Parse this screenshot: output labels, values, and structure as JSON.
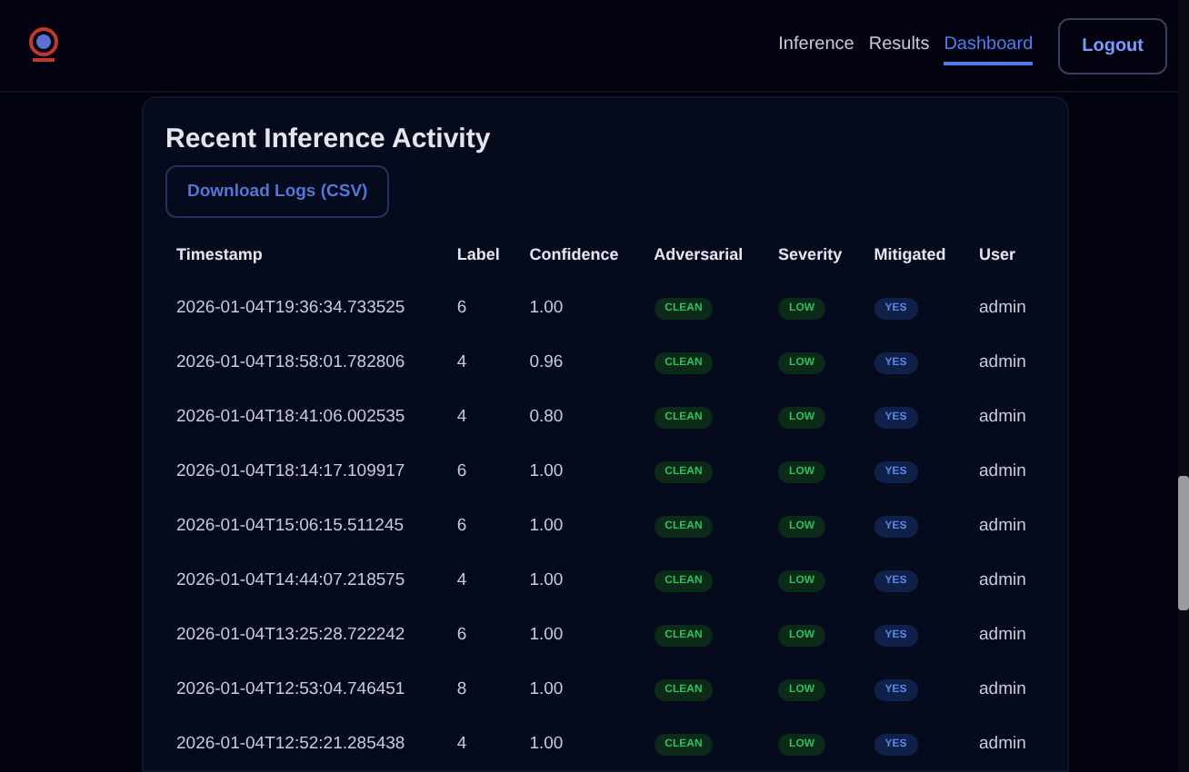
{
  "nav": {
    "links": [
      {
        "label": "Inference",
        "selected": false
      },
      {
        "label": "Results",
        "selected": false
      },
      {
        "label": "Dashboard",
        "selected": true
      }
    ],
    "logout": "Logout"
  },
  "card": {
    "title": "Recent Inference Activity",
    "download_button": "Download Logs (CSV)"
  },
  "table": {
    "columns": [
      "Timestamp",
      "Label",
      "Confidence",
      "Adversarial",
      "Severity",
      "Mitigated",
      "User"
    ],
    "rows": [
      {
        "timestamp": "2026-01-04T19:36:34.733525",
        "label": "6",
        "confidence": "1.00",
        "adversarial": "CLEAN",
        "severity": "LOW",
        "mitigated": "YES",
        "user": "admin"
      },
      {
        "timestamp": "2026-01-04T18:58:01.782806",
        "label": "4",
        "confidence": "0.96",
        "adversarial": "CLEAN",
        "severity": "LOW",
        "mitigated": "YES",
        "user": "admin"
      },
      {
        "timestamp": "2026-01-04T18:41:06.002535",
        "label": "4",
        "confidence": "0.80",
        "adversarial": "CLEAN",
        "severity": "LOW",
        "mitigated": "YES",
        "user": "admin"
      },
      {
        "timestamp": "2026-01-04T18:14:17.109917",
        "label": "6",
        "confidence": "1.00",
        "adversarial": "CLEAN",
        "severity": "LOW",
        "mitigated": "YES",
        "user": "admin"
      },
      {
        "timestamp": "2026-01-04T15:06:15.511245",
        "label": "6",
        "confidence": "1.00",
        "adversarial": "CLEAN",
        "severity": "LOW",
        "mitigated": "YES",
        "user": "admin"
      },
      {
        "timestamp": "2026-01-04T14:44:07.218575",
        "label": "4",
        "confidence": "1.00",
        "adversarial": "CLEAN",
        "severity": "LOW",
        "mitigated": "YES",
        "user": "admin"
      },
      {
        "timestamp": "2026-01-04T13:25:28.722242",
        "label": "6",
        "confidence": "1.00",
        "adversarial": "CLEAN",
        "severity": "LOW",
        "mitigated": "YES",
        "user": "admin"
      },
      {
        "timestamp": "2026-01-04T12:53:04.746451",
        "label": "8",
        "confidence": "1.00",
        "adversarial": "CLEAN",
        "severity": "LOW",
        "mitigated": "YES",
        "user": "admin"
      },
      {
        "timestamp": "2026-01-04T12:52:21.285438",
        "label": "4",
        "confidence": "1.00",
        "adversarial": "CLEAN",
        "severity": "LOW",
        "mitigated": "YES",
        "user": "admin"
      }
    ]
  }
}
